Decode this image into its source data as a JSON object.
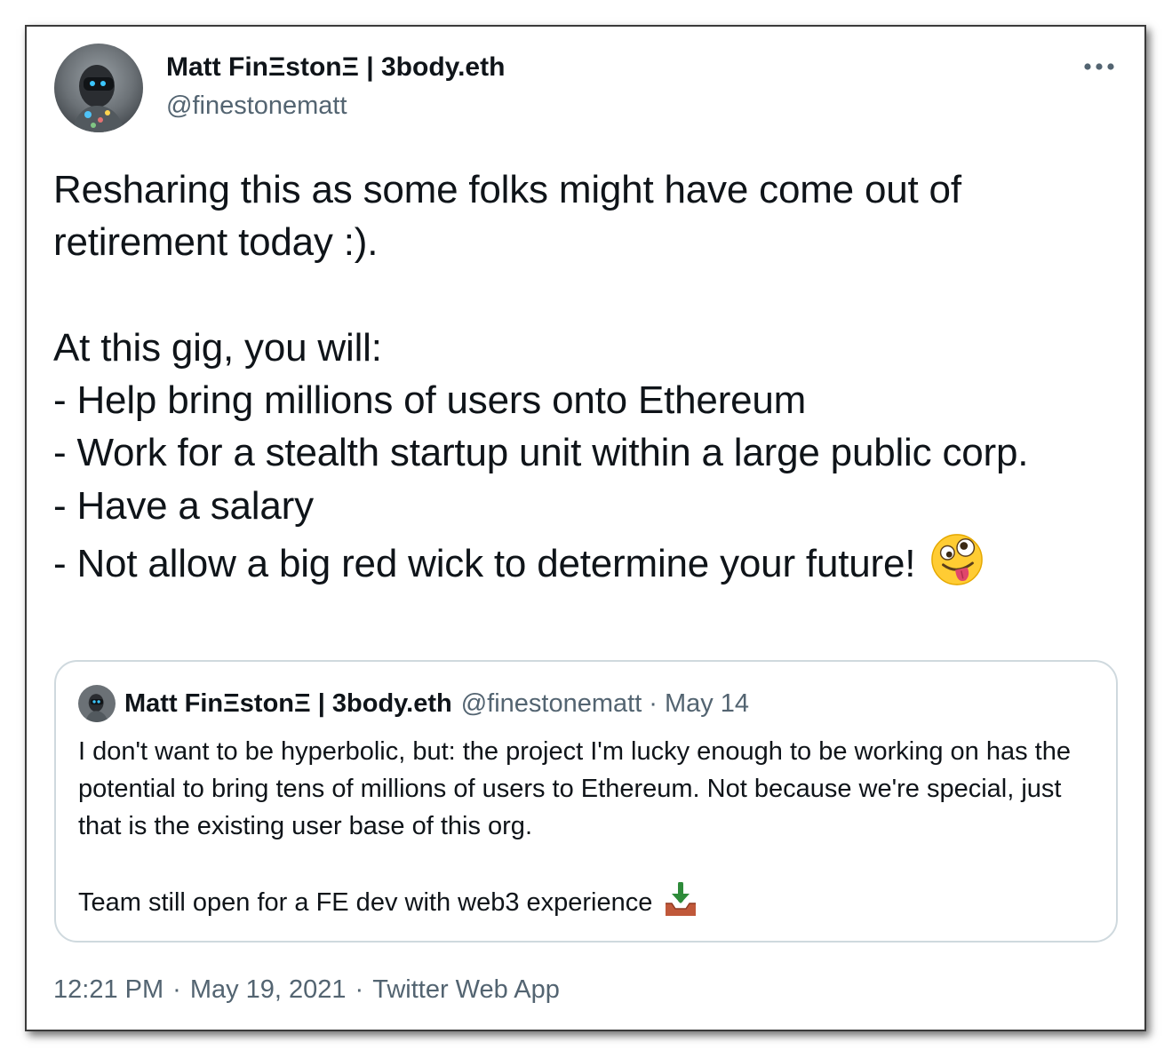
{
  "tweet": {
    "author": {
      "name": "Matt FinΞstonΞ | 3body.eth",
      "handle": "@finestonematt"
    },
    "more_icon": "more-horizontal-icon",
    "body": "Resharing this as some folks might have come out of retirement today :).\n\nAt this gig, you will:\n- Help bring millions of users onto Ethereum\n- Work for a stealth startup unit within a large public corp.\n- Have a salary\n- Not allow a big red wick to determine your future!",
    "body_emoji": "zany-face-emoji",
    "quote": {
      "name": "Matt FinΞstonΞ | 3body.eth",
      "handle": "@finestonematt",
      "separator": "·",
      "date": "May 14",
      "text": "I don't want to be hyperbolic, but: the project I'm lucky enough to be working on has the potential to bring tens of millions of users to Ethereum. Not because we're special, just that is the existing user base of this org.\n\nTeam still open for a FE dev with web3 experience",
      "text_emoji": "inbox-tray-emoji"
    },
    "meta": {
      "time": "12:21 PM",
      "separator": "·",
      "date": "May 19, 2021",
      "source": "Twitter Web App"
    }
  },
  "colors": {
    "text": "#0f1419",
    "secondary": "#536471",
    "border": "#cfd9de",
    "frame": "#3a3a3a"
  }
}
